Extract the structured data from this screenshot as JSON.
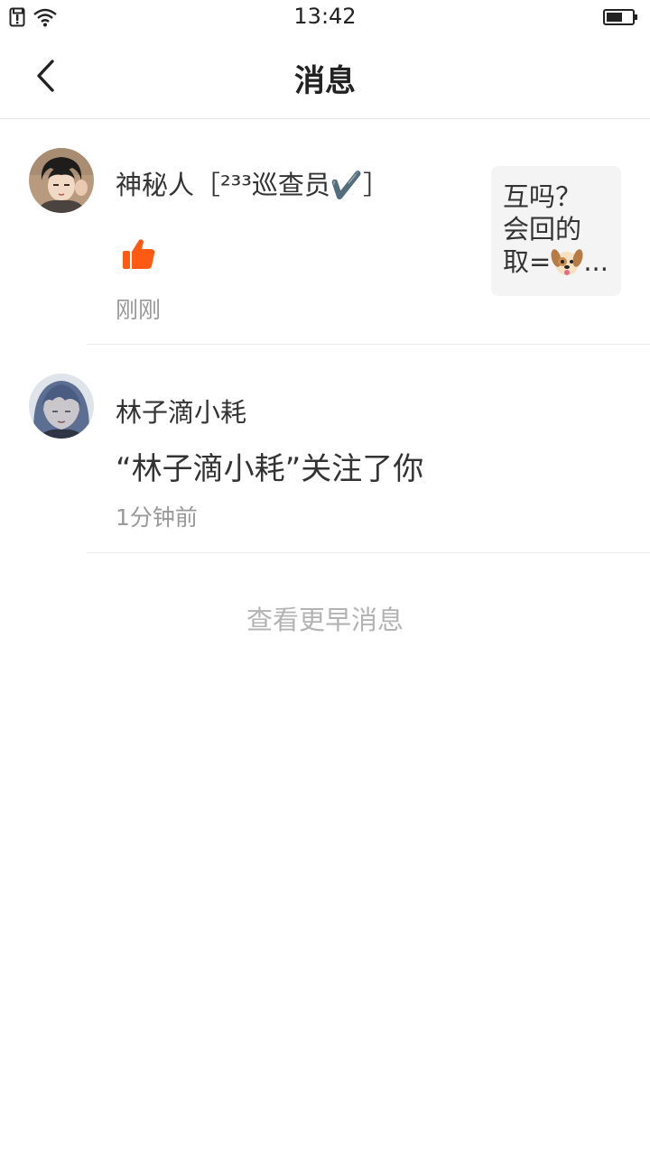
{
  "status_bar": {
    "time": "13:42",
    "icons": [
      "sim-alert-icon",
      "wifi-icon",
      "battery-icon"
    ]
  },
  "header": {
    "title": "消息",
    "back_icon": "chevron-left-icon"
  },
  "messages": [
    {
      "username": "神秘人［²³³巡查员✔️］",
      "action_icon": "thumbs-up-icon",
      "time": "刚刚",
      "quote_lines": [
        "互吗？",
        "会回的",
        "取="
      ],
      "quote_emoji": "dog-face-icon",
      "quote_ellipsis": "..."
    },
    {
      "username": "林子滴小耗",
      "content": "“林子滴小耗”关注了你",
      "time": "1分钟前"
    }
  ],
  "more_link": "查看更早消息",
  "colors": {
    "like_orange": "#ff5a14",
    "muted_text": "#999999",
    "quote_bg": "#f4f4f4"
  }
}
